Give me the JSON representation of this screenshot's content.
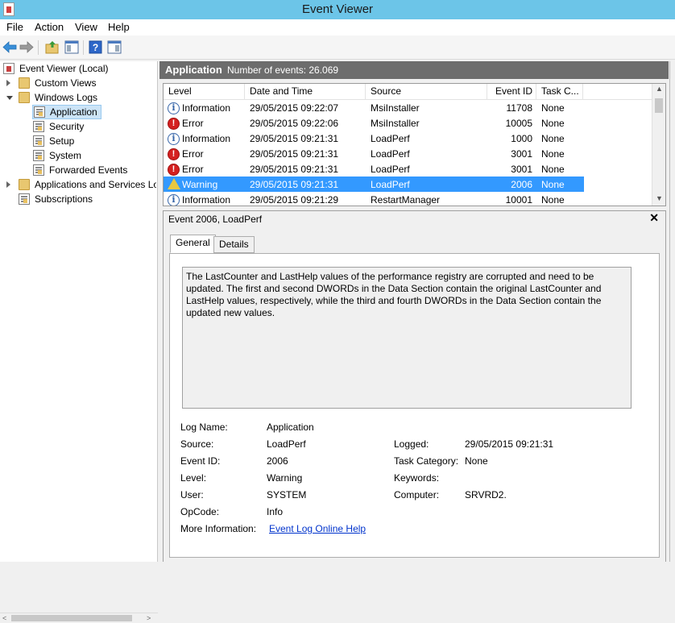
{
  "window": {
    "title": "Event Viewer"
  },
  "menu": [
    "File",
    "Action",
    "View",
    "Help"
  ],
  "tree": {
    "root": "Event Viewer (Local)",
    "custom_views": "Custom Views",
    "windows_logs": "Windows Logs",
    "logs": [
      "Application",
      "Security",
      "Setup",
      "System",
      "Forwarded Events"
    ],
    "apps_services": "Applications and Services Lo",
    "subscriptions": "Subscriptions"
  },
  "log_header": {
    "name": "Application",
    "count": "Number of events: 26.069"
  },
  "columns": [
    "Level",
    "Date and Time",
    "Source",
    "Event ID",
    "Task C..."
  ],
  "events": [
    {
      "level": "Information",
      "icon": "info",
      "datetime": "29/05/2015 09:22:07",
      "source": "MsiInstaller",
      "id": "11708",
      "task": "None"
    },
    {
      "level": "Error",
      "icon": "error",
      "datetime": "29/05/2015 09:22:06",
      "source": "MsiInstaller",
      "id": "10005",
      "task": "None"
    },
    {
      "level": "Information",
      "icon": "info",
      "datetime": "29/05/2015 09:21:31",
      "source": "LoadPerf",
      "id": "1000",
      "task": "None"
    },
    {
      "level": "Error",
      "icon": "error",
      "datetime": "29/05/2015 09:21:31",
      "source": "LoadPerf",
      "id": "3001",
      "task": "None"
    },
    {
      "level": "Error",
      "icon": "error",
      "datetime": "29/05/2015 09:21:31",
      "source": "LoadPerf",
      "id": "3001",
      "task": "None"
    },
    {
      "level": "Warning",
      "icon": "warning",
      "datetime": "29/05/2015 09:21:31",
      "source": "LoadPerf",
      "id": "2006",
      "task": "None",
      "selected": true
    },
    {
      "level": "Information",
      "icon": "info",
      "datetime": "29/05/2015 09:21:29",
      "source": "RestartManager",
      "id": "10001",
      "task": "None"
    }
  ],
  "detail": {
    "title": "Event 2006, LoadPerf",
    "close": "✕",
    "tabs": [
      "General",
      "Details"
    ],
    "description": "The LastCounter and LastHelp values of the performance registry are corrupted and need to be updated. The first and second DWORDs in the Data Section contain the original LastCounter and LastHelp values, respectively, while the third and fourth DWORDs in the Data Section contain the updated new values.",
    "labels": {
      "log_name": "Log Name:",
      "source": "Source:",
      "event_id": "Event ID:",
      "level": "Level:",
      "user": "User:",
      "opcode": "OpCode:",
      "more_info": "More Information:",
      "logged": "Logged:",
      "task_category": "Task Category:",
      "keywords": "Keywords:",
      "computer": "Computer:"
    },
    "values": {
      "log_name": "Application",
      "source": "LoadPerf",
      "event_id": "2006",
      "level": "Warning",
      "user": "SYSTEM",
      "opcode": "Info",
      "more_info": "Event Log Online Help",
      "logged": "29/05/2015 09:21:31",
      "task_category": "None",
      "keywords": "",
      "computer": "SRVRD2."
    }
  }
}
